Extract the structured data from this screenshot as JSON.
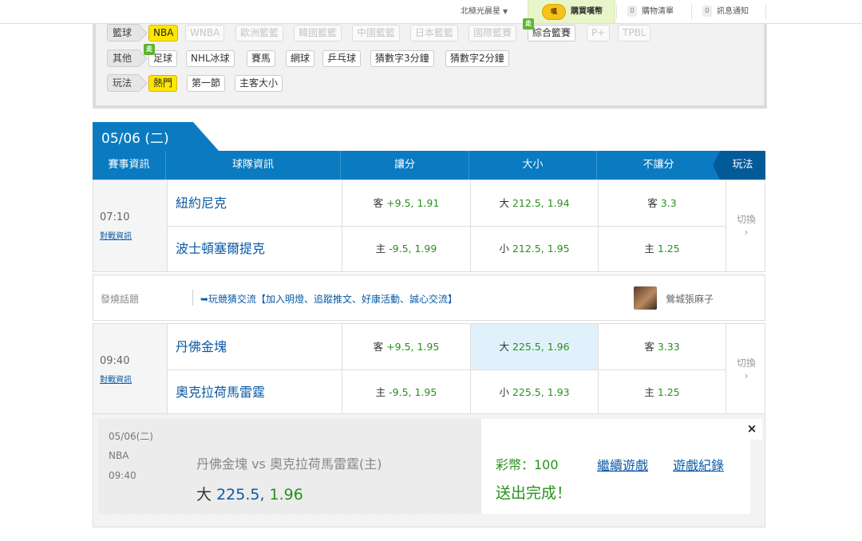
{
  "topbar": {
    "user": "北極光晨星",
    "buy_coin_icon": "coin-icon",
    "buy_coin_icon_text": "嘆",
    "buy": "購買嘆幣",
    "cart_count": "0",
    "cart": "購物清單",
    "msg_count": "0",
    "msg": "訊息通知"
  },
  "filters": {
    "row1": {
      "label": "籃球",
      "options": [
        "NBA",
        "WNBA",
        "歐洲籃籃",
        "韓國籃籃",
        "中國籃籃",
        "日本籃籃",
        "國際籃賽",
        "綜合籃賽",
        "P+",
        "TPBL"
      ],
      "selected": "NBA"
    },
    "row2": {
      "label": "其他",
      "options": [
        "足球",
        "NHL冰球",
        "賽馬",
        "網球",
        "乒乓球",
        "猜數字3分鐘",
        "猜數字2分鐘"
      ]
    },
    "row3": {
      "label": "玩法",
      "options": [
        "熱門",
        "第一節",
        "主客大小"
      ],
      "selected": "熱門"
    },
    "walk_badge": "走"
  },
  "date_tab": "05/06 (二)",
  "table_header": [
    "賽事資訊",
    "球隊資訊",
    "讓分",
    "大小",
    "不讓分"
  ],
  "play_label": "玩法",
  "games": [
    {
      "time": "07:10",
      "info_link": "對戰資訊",
      "away": "紐約尼克",
      "home": "波士頓塞爾提克",
      "spread_away": {
        "side": "客",
        "line": "+9.5",
        "odds": "1.91"
      },
      "spread_home": {
        "side": "主",
        "line": "-9.5",
        "odds": "1.99"
      },
      "total_over": {
        "side": "大",
        "line": "212.5",
        "odds": "1.94"
      },
      "total_under": {
        "side": "小",
        "line": "212.5",
        "odds": "1.95"
      },
      "ml_away": {
        "side": "客",
        "odds": "3.3"
      },
      "ml_home": {
        "side": "主",
        "odds": "1.25"
      },
      "switch": "切換",
      "switch_arrow": "›"
    },
    {
      "time": "09:40",
      "info_link": "對戰資訊",
      "away": "丹佛金塊",
      "home": "奧克拉荷馬雷霆",
      "spread_away": {
        "side": "客",
        "line": "+9.5",
        "odds": "1.95"
      },
      "spread_home": {
        "side": "主",
        "line": "-9.5",
        "odds": "1.95"
      },
      "total_over": {
        "side": "大",
        "line": "225.5",
        "odds": "1.96"
      },
      "total_under": {
        "side": "小",
        "line": "225.5",
        "odds": "1.93"
      },
      "ml_away": {
        "side": "客",
        "odds": "3.33"
      },
      "ml_home": {
        "side": "主",
        "odds": "1.25"
      },
      "switch": "切換",
      "switch_arrow": "›"
    }
  ],
  "topic": {
    "label": "發燒話題",
    "link": "➥玩競猜交流【加入明燈、追蹤推文、好康活動、誠心交流】",
    "user": "鶯城張麻子"
  },
  "bet_slip": {
    "date": "05/06(二)",
    "league": "NBA",
    "time": "09:40",
    "match": "丹佛金塊 vs 奧克拉荷馬雷霆(主)",
    "pick_side": "大",
    "pick_line": "225.5,",
    "pick_odds": "1.96",
    "coins": "彩幣：100",
    "status": "送出完成！",
    "continue": "繼續遊戲",
    "record": "遊戲紀錄",
    "close": "×"
  },
  "colors": {
    "header_blue": "#0a7bc1",
    "play_dark": "#035a99",
    "odds_green": "#27911c",
    "link_blue": "#0a5aa5",
    "selected_yellow": "#ffe600",
    "highlight": "#e1f1fb"
  }
}
